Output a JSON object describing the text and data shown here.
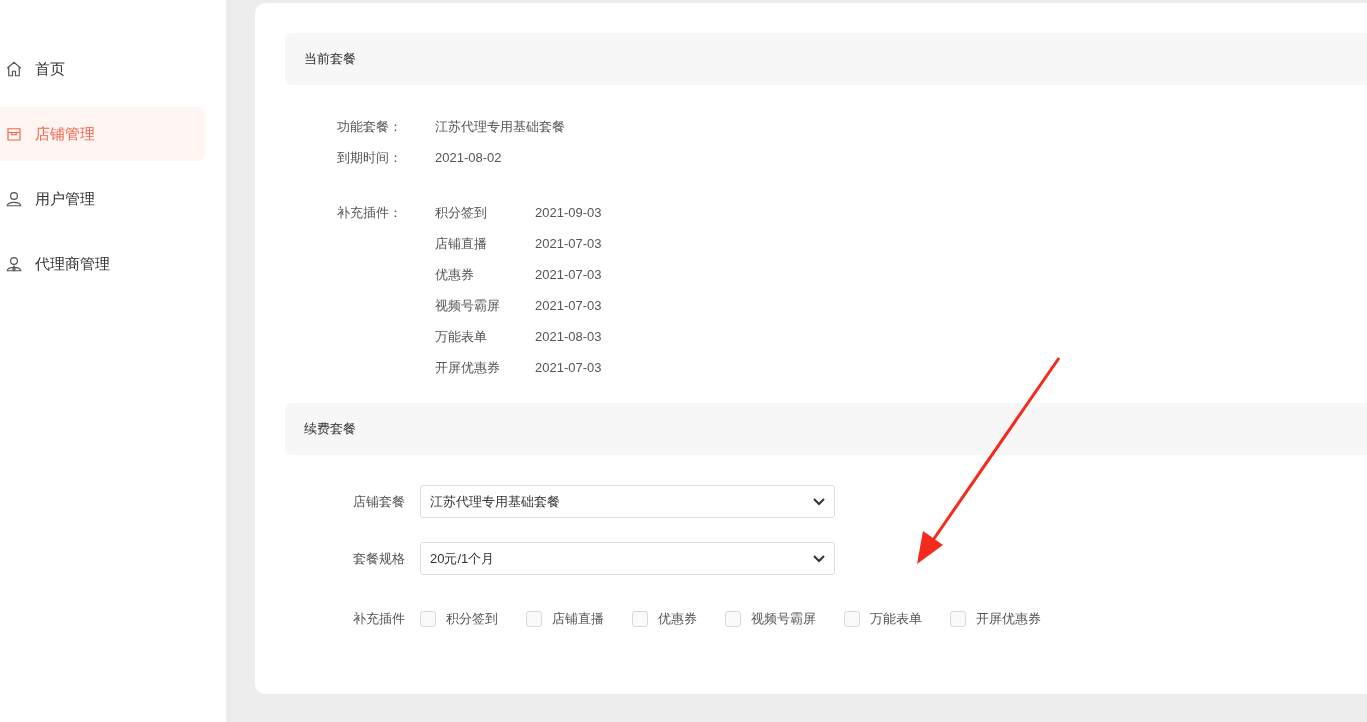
{
  "sidebar": {
    "items": [
      {
        "label": "首页",
        "kind": "home",
        "selected": false
      },
      {
        "label": "店铺管理",
        "kind": "store",
        "selected": true
      },
      {
        "label": "用户管理",
        "kind": "user",
        "selected": false
      },
      {
        "label": "代理商管理",
        "kind": "agent",
        "selected": false
      }
    ]
  },
  "current_plan": {
    "title": "当前套餐",
    "fields": [
      {
        "label": "功能套餐：",
        "value": "江苏代理专用基础套餐"
      },
      {
        "label": "到期时间：",
        "value": "2021-08-02"
      }
    ],
    "plugins_label": "补充插件：",
    "plugins": [
      {
        "name": "积分签到",
        "date": "2021-09-03"
      },
      {
        "name": "店铺直播",
        "date": "2021-07-03"
      },
      {
        "name": "优惠券",
        "date": "2021-07-03"
      },
      {
        "name": "视频号霸屏",
        "date": "2021-07-03"
      },
      {
        "name": "万能表单",
        "date": "2021-08-03"
      },
      {
        "name": "开屏优惠券",
        "date": "2021-07-03"
      }
    ]
  },
  "renewal": {
    "title": "续费套餐",
    "selects": [
      {
        "label": "店铺套餐",
        "value": "江苏代理专用基础套餐"
      },
      {
        "label": "套餐规格",
        "value": "20元/1个月"
      }
    ],
    "plugins_label": "补充插件",
    "plugins": [
      {
        "label": "积分签到",
        "checked": false
      },
      {
        "label": "店铺直播",
        "checked": false
      },
      {
        "label": "优惠券",
        "checked": false
      },
      {
        "label": "视频号霸屏",
        "checked": false
      },
      {
        "label": "万能表单",
        "checked": false
      },
      {
        "label": "开屏优惠券",
        "checked": false
      }
    ]
  }
}
